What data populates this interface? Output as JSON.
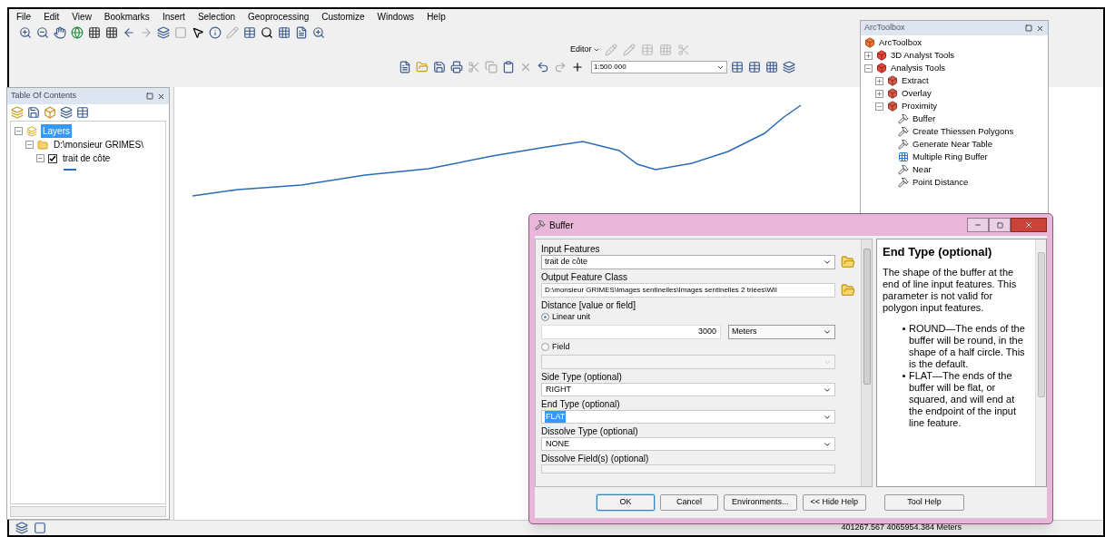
{
  "menu": [
    "File",
    "Edit",
    "View",
    "Bookmarks",
    "Insert",
    "Selection",
    "Geoprocessing",
    "Customize",
    "Windows",
    "Help"
  ],
  "editor_toolbar": {
    "label": "Editor"
  },
  "standard_toolbar": {
    "scale": "1:500 000"
  },
  "toc": {
    "title": "Table Of Contents",
    "tree": [
      {
        "label": "Layers",
        "kind": "frame",
        "selected": true,
        "expanded": true,
        "children": [
          {
            "label": "D:\\monsieur GRIMES\\",
            "kind": "folder",
            "selected": false,
            "expanded": true,
            "children": [
              {
                "label": "trait de côte",
                "kind": "layer",
                "selected": false,
                "expanded": true,
                "checked": true
              }
            ]
          }
        ]
      }
    ]
  },
  "toolbox": {
    "title": "ArcToolbox",
    "tree": [
      {
        "label": "ArcToolbox",
        "kind": "root"
      },
      {
        "label": "3D Analyst Tools",
        "kind": "toolbox",
        "expanded": false
      },
      {
        "label": "Analysis Tools",
        "kind": "toolbox",
        "expanded": true,
        "children": [
          {
            "label": "Extract",
            "kind": "toolset",
            "expanded": false
          },
          {
            "label": "Overlay",
            "kind": "toolset",
            "expanded": false
          },
          {
            "label": "Proximity",
            "kind": "toolset",
            "expanded": true,
            "children": [
              {
                "label": "Buffer",
                "kind": "tool"
              },
              {
                "label": "Create Thiessen Polygons",
                "kind": "tool"
              },
              {
                "label": "Generate Near Table",
                "kind": "tool"
              },
              {
                "label": "Multiple Ring Buffer",
                "kind": "script"
              },
              {
                "label": "Near",
                "kind": "tool"
              },
              {
                "label": "Point Distance",
                "kind": "tool"
              }
            ]
          }
        ]
      }
    ]
  },
  "dialog": {
    "title": "Buffer",
    "input_features": {
      "label": "Input Features",
      "value": "trait de côte"
    },
    "output_feature_class": {
      "label": "Output Feature Class",
      "value": "D:\\monsieur GRIMES\\Images sentinelles\\Images sentinelles 2 triées\\Wil"
    },
    "distance": {
      "label": "Distance [value or field]",
      "options": [
        {
          "label": "Linear unit",
          "selected": true
        },
        {
          "label": "Field",
          "selected": false
        }
      ],
      "value": "3000",
      "unit": "Meters"
    },
    "side_type": {
      "label": "Side Type (optional)",
      "value": "RIGHT",
      "text_selected": false
    },
    "end_type": {
      "label": "End Type (optional)",
      "value": "FLAT",
      "text_selected": true
    },
    "dissolve_type": {
      "label": "Dissolve Type (optional)",
      "value": "NONE",
      "text_selected": false
    },
    "dissolve_field": {
      "label": "Dissolve Field(s) (optional)"
    },
    "buttons": [
      {
        "label": "OK",
        "default": true
      },
      {
        "label": "Cancel",
        "default": false
      },
      {
        "label": "Environments...",
        "default": false
      },
      {
        "label": "<< Hide Help",
        "default": false
      },
      {
        "label": "Tool Help",
        "default": false
      }
    ],
    "help": {
      "title": "End Type (optional)",
      "intro": "The shape of the buffer at the end of line input features. This parameter is not valid for polygon input features.",
      "bullets": [
        "ROUND—The ends of the buffer will be round, in the shape of a half circle. This is the default.",
        "FLAT—The ends of the buffer will be flat, or squared, and will end at the endpoint of the input line feature."
      ]
    }
  },
  "status_bar": {
    "coordinates": "401267.567  4065954.384 Meters"
  }
}
